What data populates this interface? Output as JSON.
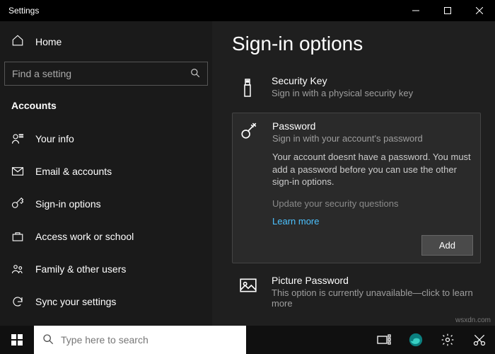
{
  "titlebar": {
    "title": "Settings"
  },
  "sidebar": {
    "home": "Home",
    "search_placeholder": "Find a setting",
    "section": "Accounts",
    "items": [
      {
        "label": "Your info"
      },
      {
        "label": "Email & accounts"
      },
      {
        "label": "Sign-in options"
      },
      {
        "label": "Access work or school"
      },
      {
        "label": "Family & other users"
      },
      {
        "label": "Sync your settings"
      }
    ]
  },
  "content": {
    "heading": "Sign-in options",
    "security_key": {
      "title": "Security Key",
      "sub": "Sign in with a physical security key"
    },
    "password": {
      "title": "Password",
      "sub": "Sign in with your account's password",
      "desc": "Your account doesnt have a password. You must add a password before you can use the other sign-in options.",
      "update": "Update your security questions",
      "learn": "Learn more",
      "add": "Add"
    },
    "picture": {
      "title": "Picture Password",
      "sub": "This option is currently unavailable—click to learn more"
    }
  },
  "taskbar": {
    "search_placeholder": "Type here to search"
  },
  "watermark": "wsxdn.com"
}
